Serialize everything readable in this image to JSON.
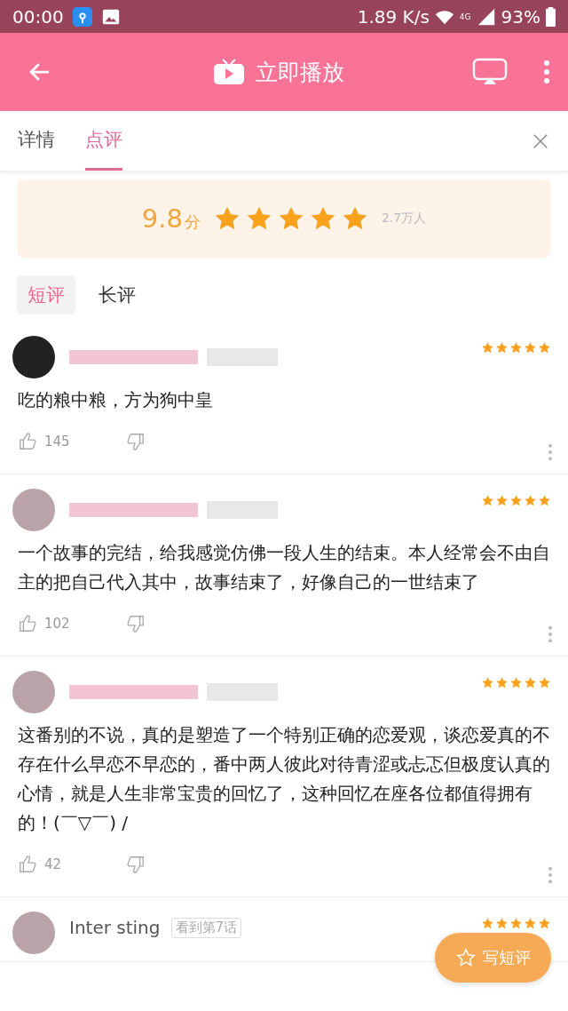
{
  "status_bar": {
    "time": "00:00",
    "speed": "1.89 K/s",
    "network": "4G",
    "battery": "93%"
  },
  "app_bar": {
    "title": "立即播放"
  },
  "tabs": [
    {
      "label": "详情",
      "selected": false
    },
    {
      "label": "点评",
      "selected": true
    }
  ],
  "rating": {
    "score": "9.8",
    "unit": "分",
    "stars": 5,
    "count": "2.7万人"
  },
  "sub_tabs": [
    {
      "label": "短评",
      "selected": true
    },
    {
      "label": "长评",
      "selected": false
    }
  ],
  "reviews": [
    {
      "stars": 5,
      "text": "吃的粮中粮，方为狗中皇",
      "likes": "145"
    },
    {
      "stars": 5,
      "text": "一个故事的完结，给我感觉仿佛一段人生的结束。本人经常会不由自主的把自己代入其中，故事结束了，好像自己的一世结束了",
      "likes": "102"
    },
    {
      "stars": 5,
      "text": "这番别的不说，真的是塑造了一个特别正确的恋爱观，谈恋爱真的不存在什么早恋不早恋的，番中两人彼此对待青涩或忐忑但极度认真的心情，就是人生非常宝贵的回忆了，这种回忆在座各位都值得拥有的！(￣▽￣) /",
      "likes": "42"
    },
    {
      "stars": 5,
      "name": "Inter  sting",
      "badge": "看到第7话"
    }
  ],
  "fab": {
    "label": "写短评"
  }
}
